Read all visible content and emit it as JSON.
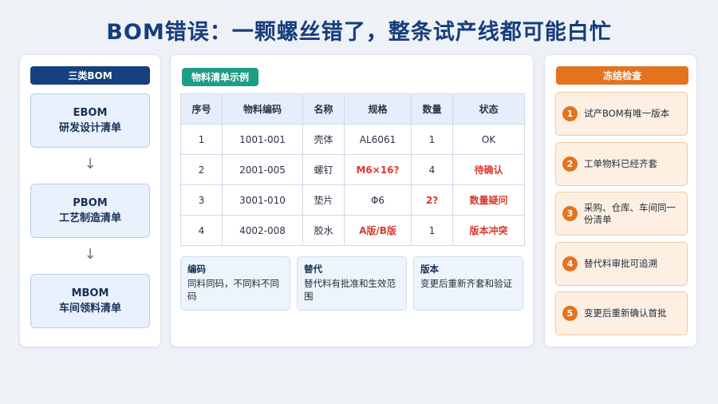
{
  "title": "BOM错误：一颗螺丝错了，整条试产线都可能白忙",
  "left": {
    "header": "三类BOM",
    "boms": [
      {
        "code": "EBOM",
        "name": "研发设计清单"
      },
      {
        "code": "PBOM",
        "name": "工艺制造清单"
      },
      {
        "code": "MBOM",
        "name": "车间领料清单"
      }
    ],
    "arrow": "↓"
  },
  "middle": {
    "header": "物料清单示例",
    "columns": [
      "序号",
      "物料编码",
      "名称",
      "规格",
      "数量",
      "状态"
    ],
    "rows": [
      [
        "1",
        "1001-001",
        "壳体",
        "AL6061",
        "1",
        "OK"
      ],
      [
        "2",
        "2001-005",
        "螺钉",
        "M6×16?",
        "4",
        "待确认"
      ],
      [
        "3",
        "3001-010",
        "垫片",
        "Φ6",
        "2?",
        "数量疑问"
      ],
      [
        "4",
        "4002-008",
        "胶水",
        "A版/B版",
        "1",
        "版本冲突"
      ]
    ],
    "notes": [
      {
        "title": "编码",
        "body": "同料同码，不同料不同码"
      },
      {
        "title": "替代",
        "body": "替代料有批准和生效范围"
      },
      {
        "title": "版本",
        "body": "变更后重新齐套和验证"
      }
    ]
  },
  "right": {
    "header": "冻结检查",
    "items": [
      {
        "num": "1",
        "text": "试产BOM有唯一版本"
      },
      {
        "num": "2",
        "text": "工单物料已经齐套"
      },
      {
        "num": "3",
        "text": "采购、仓库、车间同一份清单"
      },
      {
        "num": "4",
        "text": "替代料审批可追溯"
      },
      {
        "num": "5",
        "text": "变更后重新确认首批"
      }
    ]
  },
  "colors": {
    "navy": "#17407e",
    "teal": "#1d9e86",
    "orange": "#e4731f",
    "alert_red": "#d83a2c"
  }
}
